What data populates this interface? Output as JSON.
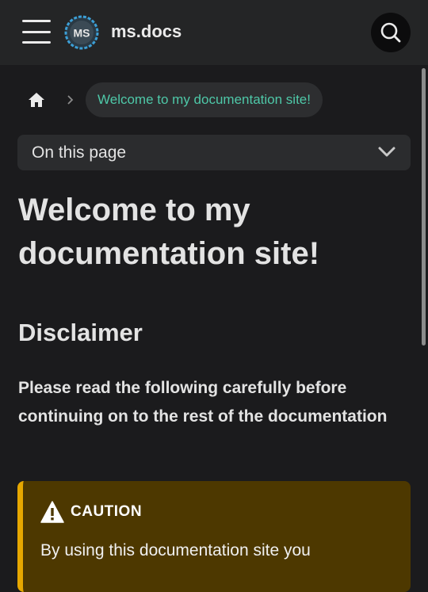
{
  "navbar": {
    "brand": "ms.docs",
    "logo_text": "MS",
    "menu_icon": "hamburger-menu-icon",
    "search_icon": "search-icon"
  },
  "breadcrumbs": {
    "home_icon": "home-icon",
    "separator_icon": "chevron-right-icon",
    "current": "Welcome to my documentation site!"
  },
  "toc": {
    "label": "On this page",
    "icon": "chevron-down-icon"
  },
  "content": {
    "title": "Welcome to my documentation site!",
    "heading": "Disclaimer",
    "lead": "Please read the following carefully before continuing on to the rest of the documentation"
  },
  "admonition": {
    "icon": "warning-icon",
    "title": "CAUTION",
    "body": "By using this documentation site you"
  },
  "colors": {
    "background": "#1b1b1d",
    "navbar": "#242526",
    "accent": "#4ec8a8",
    "caution_border": "#e6a700",
    "caution_background": "#4d3800"
  }
}
